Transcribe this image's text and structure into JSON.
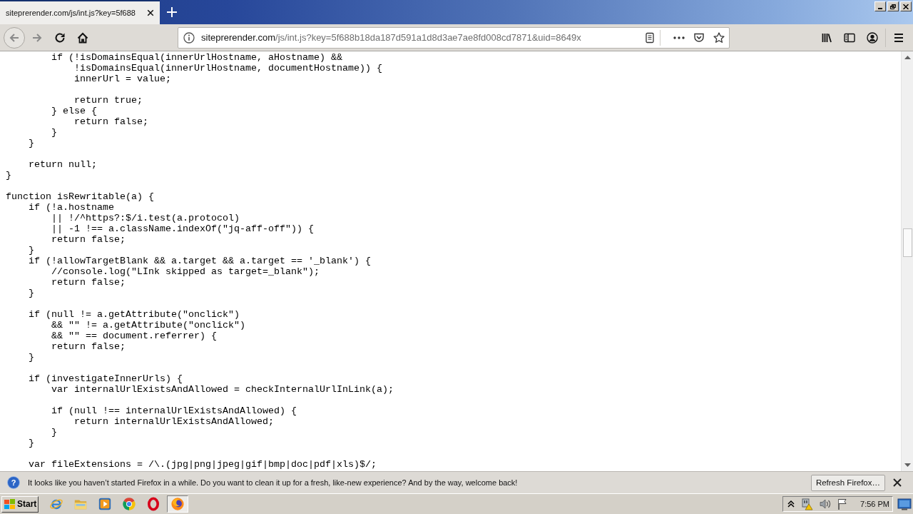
{
  "tabs": [
    {
      "title": "siteprerender.com/js/int.js?key=5f688",
      "selected": true
    }
  ],
  "nav_buttons": [
    {
      "kind": "back",
      "disabled": true
    },
    {
      "kind": "forward",
      "disabled": true
    },
    {
      "kind": "reload",
      "disabled": false
    },
    {
      "kind": "home",
      "disabled": false
    }
  ],
  "address_bar": {
    "host": "siteprerender.com",
    "path": "/js/int.js?key=5f688b18da187d591a1d8d3ae7ae8fd008cd7871&uid=8649x",
    "bookmarked": false
  },
  "code_blocks": [
    [
      "        if (!isDomainsEqual(innerUrlHostname, aHostname) &&",
      "            !isDomainsEqual(innerUrlHostname, documentHostname)) {",
      "            innerUrl = value;"
    ],
    [
      "            return true;",
      "        } else {",
      "            return false;",
      "        }",
      "    }"
    ],
    [
      "    return null;",
      "}"
    ],
    [
      "function isRewritable(a) {",
      "    if (!a.hostname",
      "        || !/^https?:$/i.test(a.protocol)",
      "        || -1 !== a.className.indexOf(\"jq-aff-off\")) {",
      "        return false;",
      "    }",
      "    if (!allowTargetBlank && a.target && a.target == '_blank') {",
      "        //console.log(\"LInk skipped as target=_blank\");",
      "        return false;",
      "    }"
    ],
    [
      "    if (null != a.getAttribute(\"onclick\")",
      "        && \"\" != a.getAttribute(\"onclick\")",
      "        && \"\" == document.referrer) {",
      "        return false;",
      "    }"
    ],
    [
      "    if (investigateInnerUrls) {",
      "        var internalUrlExistsAndAllowed = checkInternalUrlInLink(a);"
    ],
    [
      "        if (null !== internalUrlExistsAndAllowed) {",
      "            return internalUrlExistsAndAllowed;",
      "        }",
      "    }"
    ],
    [
      "    var fileExtensions = /\\.(jpg|png|jpeg|gif|bmp|doc|pdf|xls)$/;"
    ]
  ],
  "notification": {
    "icon": "?",
    "message": "It looks like you haven’t started Firefox in a while. Do you want to clean it up for a fresh, like-new experience? And by the way, welcome back!",
    "button": "Refresh Firefox…"
  },
  "taskbar": {
    "start": "Start",
    "apps": [
      {
        "kind": "ie",
        "selected": false
      },
      {
        "kind": "explorer",
        "selected": false
      },
      {
        "kind": "media",
        "selected": false
      },
      {
        "kind": "chrome",
        "selected": false
      },
      {
        "kind": "opera",
        "selected": false
      },
      {
        "kind": "firefox",
        "selected": true
      }
    ],
    "clock": "7:56 PM"
  }
}
